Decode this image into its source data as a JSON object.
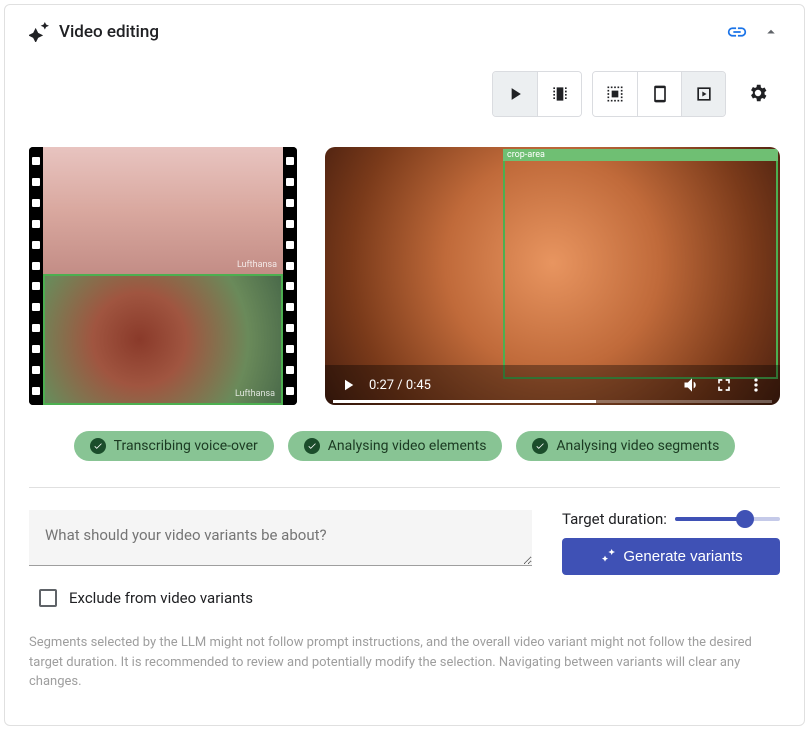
{
  "header": {
    "title": "Video editing"
  },
  "video": {
    "time_current": "0:27",
    "time_total": "0:45",
    "crop_label": "crop-area",
    "frame_label": "Lufthansa"
  },
  "status": {
    "chips": [
      "Transcribing voice-over",
      "Analysing video elements",
      "Analysing video segments"
    ]
  },
  "form": {
    "textarea_placeholder": "What should your video variants be about?",
    "target_duration_label": "Target duration:",
    "generate_label": "Generate variants",
    "exclude_label": "Exclude from video variants",
    "slider_value": 62
  },
  "disclaimer": "Segments selected by the LLM might not follow prompt instructions, and the overall video variant might not follow the desired target duration. It is recommended to review and potentially modify the selection. Navigating between variants will clear any changes.",
  "icons": {
    "sparkle": "sparkle-icon",
    "link": "link-icon",
    "chevron_up": "chevron-up-icon",
    "play": "play-icon",
    "film": "film-icon",
    "select_all": "select-all-icon",
    "mobile": "mobile-icon",
    "preview_box": "preview-box-icon",
    "gear": "gear-icon",
    "volume": "volume-icon",
    "fullscreen": "fullscreen-icon",
    "more": "more-vert-icon",
    "check": "check-icon",
    "magic": "magic-wand-icon"
  }
}
